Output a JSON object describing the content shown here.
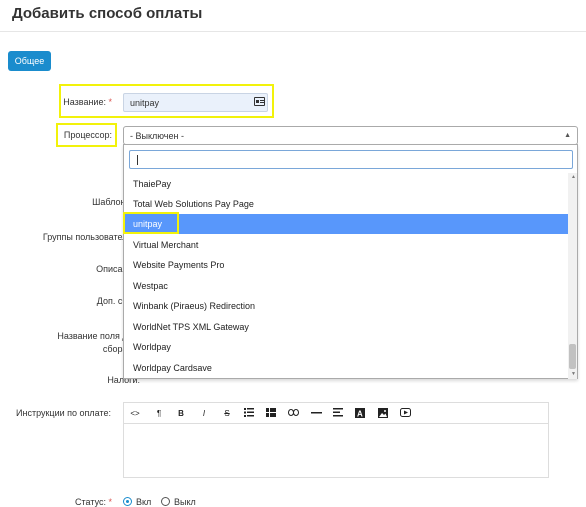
{
  "page_title": "Добавить способ оплаты",
  "tab_general": "Общее",
  "fields": {
    "name_label": "Название:",
    "name_required": "*",
    "name_value": "unitpay",
    "processor_label": "Процессор:",
    "processor_selected": "- Выключен -",
    "template_label": "Шаблон",
    "user_groups_label": "Группы пользователей:",
    "description_label": "Описание:",
    "surcharge_label": "Доп. сбор:",
    "surcharge_field_name_label_1": "Название поля доп.",
    "surcharge_field_name_label_2": "сбора",
    "taxes_label": "Налоги:",
    "instructions_label": "Инструкции по оплате:",
    "status_label": "Статус:",
    "status_required": "*",
    "status_on": "Вкл",
    "status_off": "Выкл"
  },
  "dropdown": {
    "search_value": "",
    "options": [
      "ThaiePay",
      "Total Web Solutions Pay Page",
      "unitpay",
      "Virtual Merchant",
      "Website Payments Pro",
      "Westpac",
      "Winbank (Piraeus) Redirection",
      "WorldNet TPS XML Gateway",
      "Worldpay",
      "Worldpay Cardsave"
    ],
    "selected_option": "unitpay"
  },
  "toolbar_icons": [
    "code-icon",
    "paragraph-icon",
    "bold-icon",
    "italic-icon",
    "strikethrough-icon",
    "bullet-list-icon",
    "table-icon",
    "link-icon",
    "horizontal-rule-icon",
    "align-icon",
    "font-icon",
    "image-icon",
    "video-icon"
  ],
  "toolbar_glyphs": {
    "code": "<>",
    "paragraph": "¶",
    "bold": "B",
    "italic": "I",
    "strike": "S"
  },
  "colors": {
    "primary": "#1a8ccd",
    "highlight": "#f2f20a",
    "selected_option": "#5897fb"
  }
}
